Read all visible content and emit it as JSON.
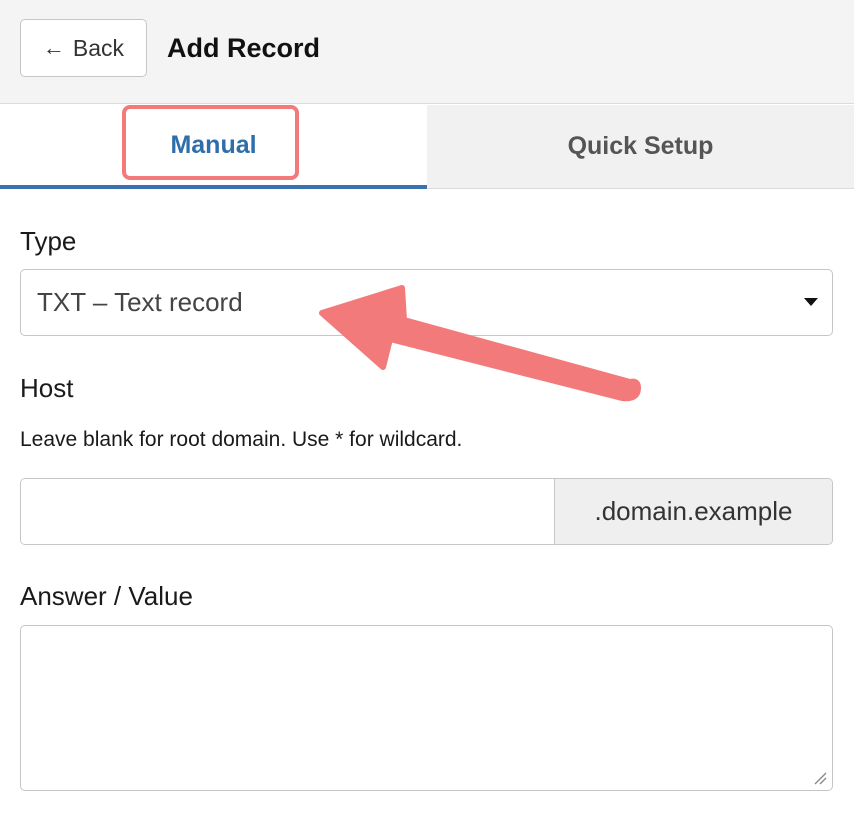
{
  "header": {
    "back_label": "Back",
    "back_icon": "left-arrow-icon",
    "title": "Add Record"
  },
  "tabs": [
    {
      "label": "Manual",
      "active": true
    },
    {
      "label": "Quick Setup",
      "active": false
    }
  ],
  "form": {
    "type": {
      "label": "Type",
      "selected": "TXT – Text record"
    },
    "host": {
      "label": "Host",
      "help": "Leave blank for root domain. Use * for wildcard.",
      "value": "",
      "suffix": ".domain.example"
    },
    "answer": {
      "label": "Answer / Value",
      "value": ""
    }
  },
  "annotations": {
    "highlight_color": "#f27a7a",
    "arrow_color": "#f27a7a",
    "active_tab_color": "#2f6eaa"
  }
}
